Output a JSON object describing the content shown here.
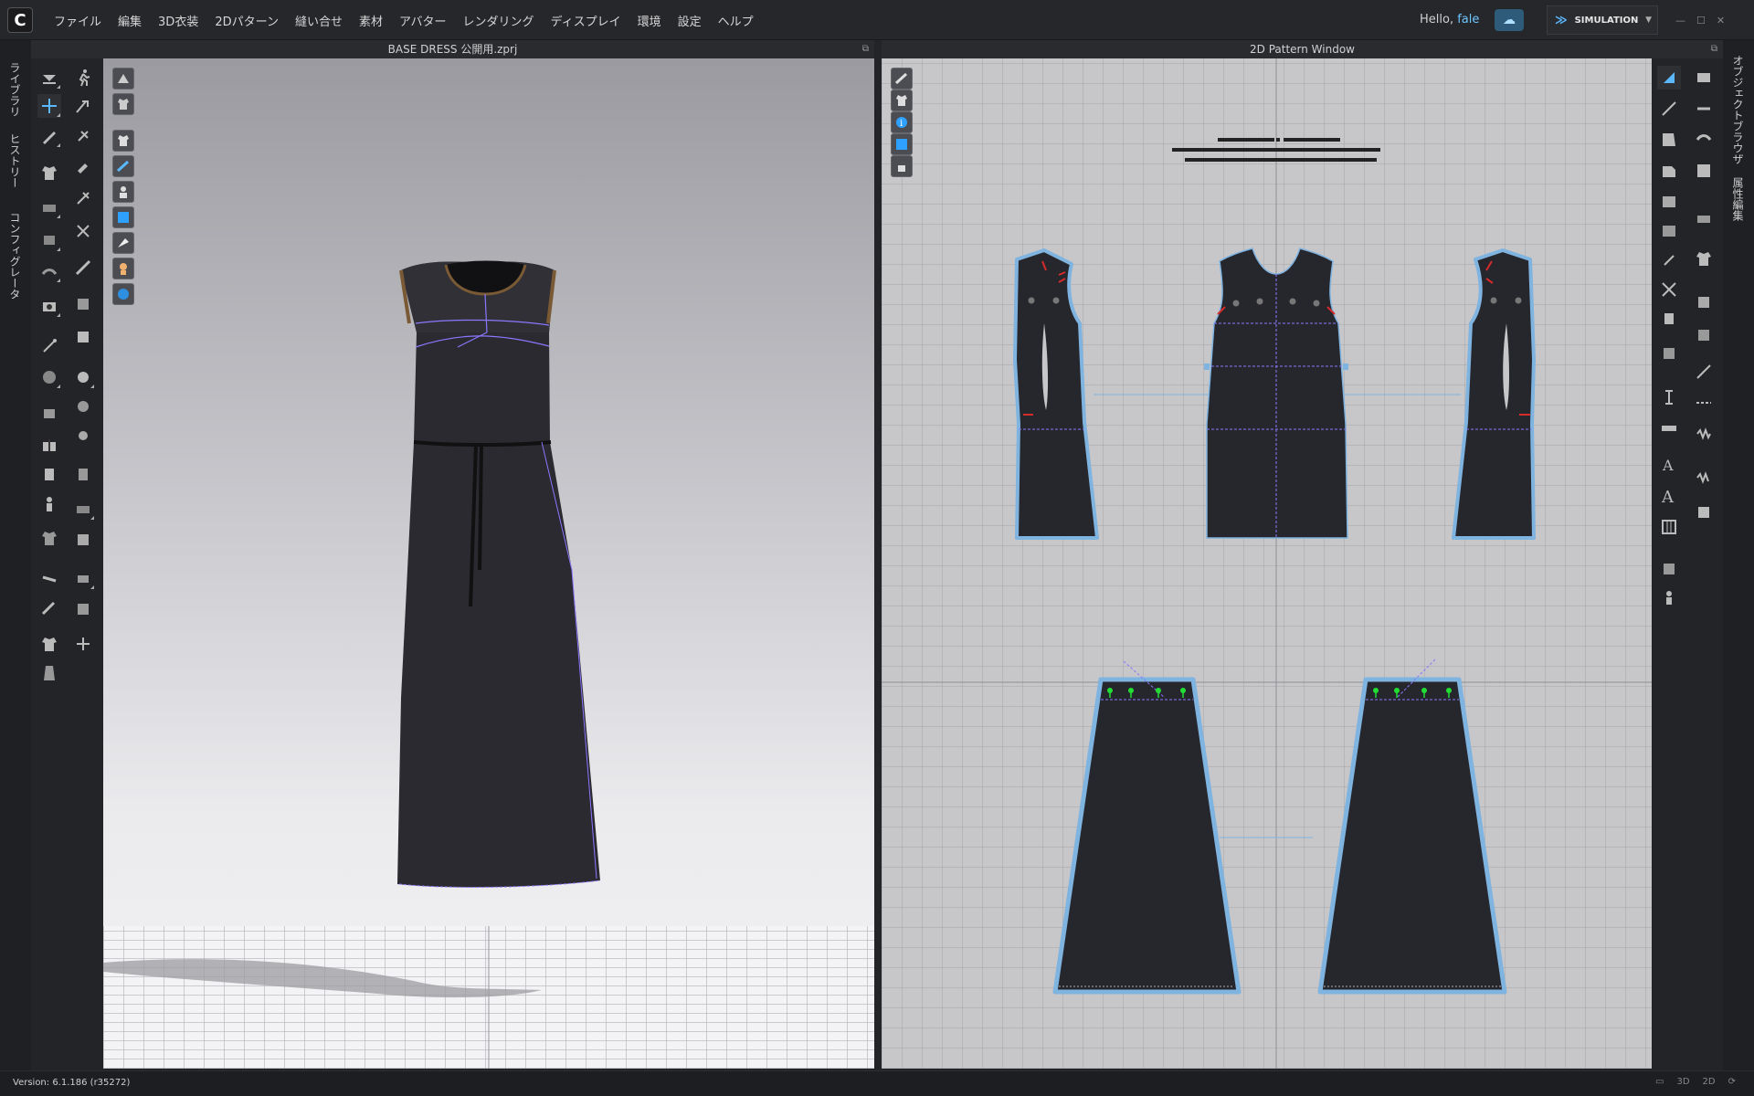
{
  "menu": {
    "items": [
      "ファイル",
      "編集",
      "3D衣装",
      "2Dパターン",
      "縫い合せ",
      "素材",
      "アバター",
      "レンダリング",
      "ディスプレイ",
      "環境",
      "設定",
      "ヘルプ"
    ]
  },
  "user": {
    "greeting": "Hello,",
    "name": "fale"
  },
  "mode": {
    "label": "SIMULATION"
  },
  "left_tabs": [
    "ライブラリ",
    "ヒストリー",
    "コンフィグレータ"
  ],
  "right_tabs": [
    "オブジェクトブラウザ",
    "属性編集"
  ],
  "panels": {
    "view3d_title": "BASE DRESS 公開用.zprj",
    "view2d_title": "2D Pattern Window"
  },
  "status": {
    "version": "Version: 6.1.186 (r35272)",
    "modes": [
      "3D",
      "2D"
    ]
  },
  "colors": {
    "accent": "#5bb8ff",
    "pattern_outline": "#7fb3e0",
    "fabric": "#26262d",
    "seam_red": "#d62b2b",
    "pin_green": "#22dd33"
  }
}
